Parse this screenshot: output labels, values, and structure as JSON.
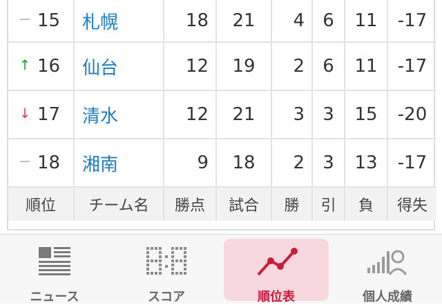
{
  "standings": {
    "rows": [
      {
        "trend": "same",
        "rank": "15",
        "team": "札幌",
        "points": "18",
        "games": "21",
        "wins": "4",
        "draws": "6",
        "losses": "11",
        "diff": "-17"
      },
      {
        "trend": "up",
        "rank": "16",
        "team": "仙台",
        "points": "12",
        "games": "19",
        "wins": "2",
        "draws": "6",
        "losses": "11",
        "diff": "-17"
      },
      {
        "trend": "down",
        "rank": "17",
        "team": "清水",
        "points": "12",
        "games": "21",
        "wins": "3",
        "draws": "3",
        "losses": "15",
        "diff": "-20"
      },
      {
        "trend": "same",
        "rank": "18",
        "team": "湘南",
        "points": "9",
        "games": "18",
        "wins": "2",
        "draws": "3",
        "losses": "13",
        "diff": "-17"
      }
    ],
    "headers": {
      "rank": "順位",
      "team": "チーム名",
      "points": "勝点",
      "games": "試合",
      "wins": "勝",
      "draws": "引",
      "losses": "負",
      "diff": "得失"
    },
    "trend_icons": {
      "same": "dash-icon",
      "up": "arrow-up-icon",
      "down": "arrow-down-icon"
    },
    "trend_colors": {
      "same": "#bbbbbb",
      "up": "#1e9e3a",
      "down": "#d9435f"
    }
  },
  "tabbar": {
    "news": {
      "label": "ニュース",
      "icon": "news-icon"
    },
    "score": {
      "label": "スコア",
      "icon": "scoreboard-icon"
    },
    "standings": {
      "label": "順位表",
      "icon": "line-chart-icon",
      "active": true
    },
    "player_stats": {
      "label": "個人成績",
      "icon": "person-stats-icon"
    }
  },
  "colors": {
    "team_link": "#1a7ec0",
    "active_tab": "#c81e3c",
    "active_tab_bg": "#f6d8de"
  }
}
